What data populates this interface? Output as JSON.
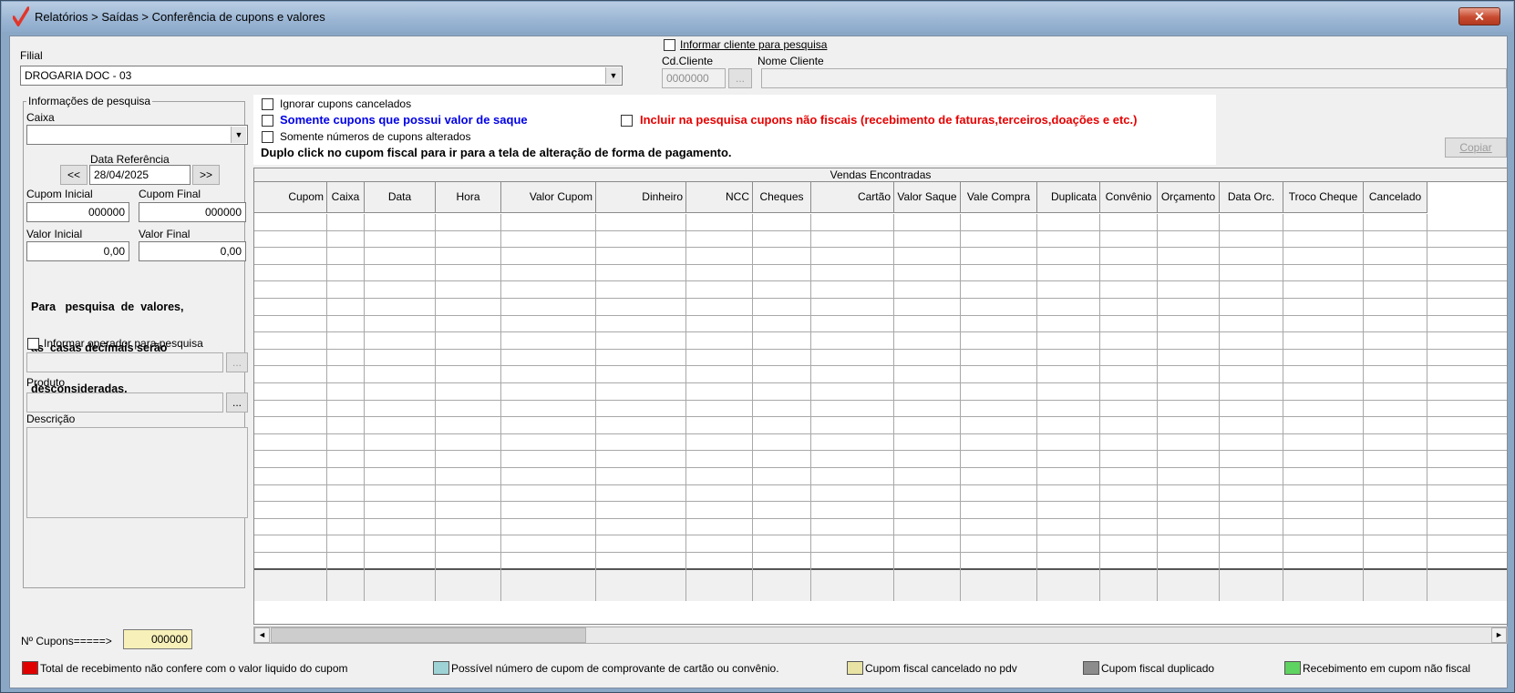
{
  "window": {
    "title": "Relatórios > Saídas > Conferência de cupons e valores",
    "close_symbol": "✕",
    "icon": "check-mark-icon"
  },
  "filial": {
    "label": "Filial",
    "value": "DROGARIA DOC - 03",
    "arrow": "▼"
  },
  "cliente": {
    "checkbox_label": "Informar cliente para pesquisa",
    "cd_label": "Cd.Cliente",
    "cd_value": "0000000",
    "lookup_label": "...",
    "nome_label": "Nome Cliente",
    "nome_value": ""
  },
  "info": {
    "title": "Informações de pesquisa",
    "caixa_label": "Caixa",
    "caixa_value": "",
    "data_ref_label": "Data Referência",
    "prev_label": "<<",
    "next_label": ">>",
    "data_ref_value": "28/04/2025",
    "cupom_inicial_label": "Cupom Inicial",
    "cupom_inicial_value": "000000",
    "cupom_final_label": "Cupom Final",
    "cupom_final_value": "000000",
    "valor_inicial_label": "Valor Inicial",
    "valor_inicial_value": "0,00",
    "valor_final_label": "Valor Final",
    "valor_final_value": "0,00",
    "note_lines": [
      "Para   pesquisa  de  valores,",
      "as  casas decimais serão",
      "desconsideradas."
    ],
    "operador_label": "Informar operador para pesquisa",
    "operador_value": "",
    "operador_lookup": "...",
    "produto_label": "Produto",
    "produto_value": "",
    "produto_lookup": "...",
    "descricao_label": "Descrição",
    "descricao_value": ""
  },
  "options": {
    "ignorar": "Ignorar cupons cancelados",
    "saque": "Somente cupons que possui valor de saque",
    "nao_fiscais": "Incluir na pesquisa cupons não fiscais (recebimento de faturas,terceiros,doações  e etc.)",
    "alterados": "Somente números de cupons alterados",
    "hint": "Duplo click no cupom fiscal para ir para a tela de alteração de forma de pagamento."
  },
  "copiar_label": "Copiar",
  "grid": {
    "caption": "Vendas Encontradas",
    "columns": [
      "Cupom",
      "Caixa",
      "Data",
      "Hora",
      "Valor Cupom",
      "Dinheiro",
      "NCC",
      "Cheques",
      "Cartão",
      "Valor Saque",
      "Vale Compra",
      "Duplicata",
      "Convênio",
      "Orçamento",
      "Data Orc.",
      "Troco Cheque",
      "Cancelado"
    ],
    "scroll_left": "◄",
    "scroll_right": "►"
  },
  "cupons": {
    "label": "Nº Cupons=====>",
    "value": "000000"
  },
  "legend": [
    {
      "color": "#e00000",
      "label": "Total de recebimento não confere com o valor liquido do cupom"
    },
    {
      "color": "#9ed3d6",
      "label": "Possível número de cupom de comprovante de cartão ou convênio."
    },
    {
      "color": "#e8e2a4",
      "label": "Cupom fiscal cancelado no pdv"
    },
    {
      "color": "#8c8c8c",
      "label": "Cupom fiscal duplicado"
    },
    {
      "color": "#5fd35f",
      "label": "Recebimento em cupom não fiscal"
    }
  ]
}
